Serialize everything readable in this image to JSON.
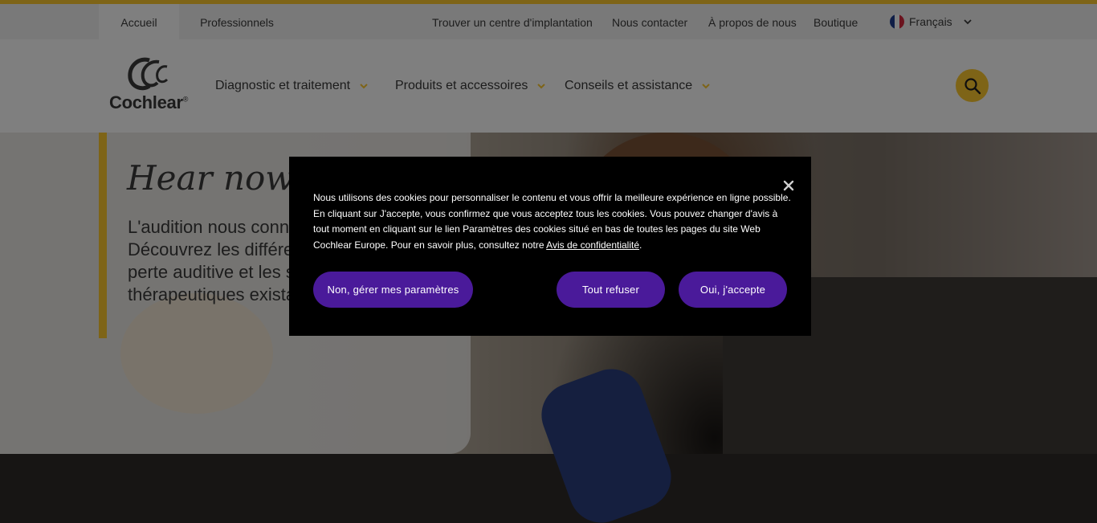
{
  "utility": {
    "tabs": [
      {
        "label": "Accueil"
      },
      {
        "label": "Professionnels"
      }
    ],
    "links": [
      {
        "label": "Trouver un centre d'implantation"
      },
      {
        "label": "Nous contacter"
      },
      {
        "label": "À propos de nous"
      },
      {
        "label": "Boutique"
      }
    ],
    "language": "Français"
  },
  "header": {
    "logo_text": "Cochlear",
    "logo_mark": "®",
    "nav": [
      {
        "label": "Diagnostic et traitement"
      },
      {
        "label": "Produits et accessoires"
      },
      {
        "label": "Conseils et assistance"
      }
    ]
  },
  "hero": {
    "title": "Hear now. An",
    "text": "L'audition nous conne\nDécouvrez les différe\nperte auditive et les s\nthérapeutiques exista"
  },
  "cookie_modal": {
    "text": "Nous utilisons des cookies pour personnaliser le contenu et vous offrir la meilleure expérience en ligne possible. En cliquant sur J'accepte, vous confirmez que vous acceptez tous les cookies. Vous pouvez changer d'avis à tout moment en cliquant sur le lien Paramètres des cookies situé en bas de toutes les pages du site Web Cochlear Europe. Pour en savoir plus, consultez notre",
    "link": "Avis de confidentialité",
    "link_suffix": ".",
    "buttons": {
      "manage": "Non, gérer mes paramètres",
      "reject": "Tout refuser",
      "accept": "Oui, j'accepte"
    }
  },
  "colors": {
    "accent": "#fdc82f",
    "button": "#4a1a9a",
    "modal_bg": "#000000"
  },
  "icons": [
    "close-icon",
    "search-icon",
    "chevron-down-icon",
    "france-flag-icon",
    "cochlear-logo-icon"
  ]
}
